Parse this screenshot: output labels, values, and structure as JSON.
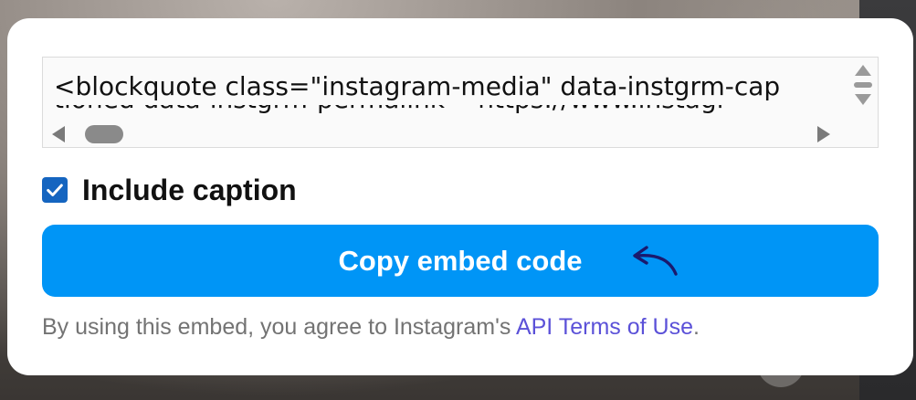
{
  "embed": {
    "code_line1": "<blockquote class=\"instagram-media\" data-instgrm-cap",
    "code_line2": "  tioned data-instgrm-permalink=\"https://www.instagr"
  },
  "caption": {
    "label": "Include caption",
    "checked": true
  },
  "copy_button": {
    "label": "Copy embed code"
  },
  "terms": {
    "prefix": "By using this embed, you agree to Instagram's ",
    "link_label": "API Terms of Use",
    "suffix": "."
  },
  "colors": {
    "button_blue": "#0095f6",
    "checkbox_blue": "#1565c0",
    "link_purple": "#5b51d8"
  }
}
